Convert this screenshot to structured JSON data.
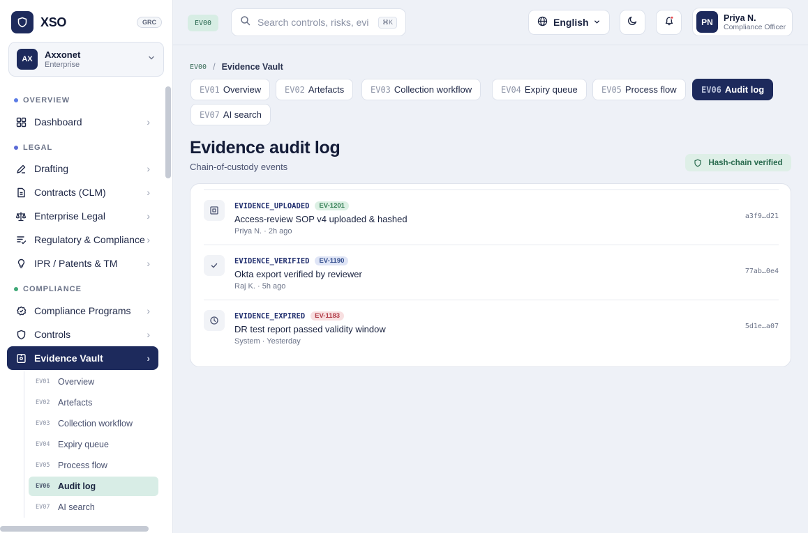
{
  "brand": {
    "name": "XSO",
    "badge": "GRC"
  },
  "org": {
    "initials": "AX",
    "name": "Axxonet",
    "plan": "Enterprise"
  },
  "sidebar": {
    "sections": [
      {
        "label": "OVERVIEW",
        "color": "#5b7ce6"
      },
      {
        "label": "LEGAL",
        "color": "#5b6bd6"
      },
      {
        "label": "COMPLIANCE",
        "color": "#3fa877"
      }
    ],
    "items": [
      {
        "label": "Dashboard",
        "icon": "grid-icon"
      },
      {
        "label": "Drafting",
        "icon": "pen-icon"
      },
      {
        "label": "Contracts (CLM)",
        "icon": "document-icon"
      },
      {
        "label": "Enterprise Legal",
        "icon": "scale-icon"
      },
      {
        "label": "Regulatory & Compliance",
        "icon": "list-check-icon"
      },
      {
        "label": "IPR / Patents & TM",
        "icon": "lightbulb-icon"
      },
      {
        "label": "Compliance Programs",
        "icon": "badge-icon"
      },
      {
        "label": "Controls",
        "icon": "shield-icon"
      },
      {
        "label": "Evidence Vault",
        "icon": "vault-icon"
      }
    ],
    "sub_items": [
      {
        "code": "EV01",
        "label": "Overview"
      },
      {
        "code": "EV02",
        "label": "Artefacts"
      },
      {
        "code": "EV03",
        "label": "Collection workflow"
      },
      {
        "code": "EV04",
        "label": "Expiry queue"
      },
      {
        "code": "EV05",
        "label": "Process flow"
      },
      {
        "code": "EV06",
        "label": "Audit log"
      },
      {
        "code": "EV07",
        "label": "AI search"
      }
    ]
  },
  "topbar": {
    "code": "EV00",
    "search_placeholder": "Search controls, risks, evidence",
    "search_shortcut": "⌘K",
    "language": "English",
    "user": {
      "initials": "PN",
      "name": "Priya N.",
      "role": "Compliance Officer"
    }
  },
  "breadcrumb": {
    "code": "EV00",
    "separator": "/",
    "label": "Evidence Vault"
  },
  "tabs": [
    {
      "code": "EV01",
      "label": "Overview"
    },
    {
      "code": "EV02",
      "label": "Artefacts"
    },
    {
      "code": "EV03",
      "label": "Collection workflow"
    },
    {
      "code": "EV04",
      "label": "Expiry queue"
    },
    {
      "code": "EV05",
      "label": "Process flow"
    },
    {
      "code": "EV06",
      "label": "Audit log"
    },
    {
      "code": "EV07",
      "label": "AI search"
    }
  ],
  "page": {
    "title": "Evidence audit log",
    "subtitle": "Chain-of-custody events",
    "verified_label": "Hash-chain verified"
  },
  "events": [
    {
      "type": "EVIDENCE_UPLOADED",
      "id": "EV-1201",
      "badge_bg": "#dcf0e4",
      "badge_fg": "#2e7a4f",
      "icon": "upload-box-icon",
      "description": "Access-review SOP v4 uploaded & hashed",
      "meta": "Priya N. · 2h ago",
      "hash": "a3f9…d21"
    },
    {
      "type": "EVIDENCE_VERIFIED",
      "id": "EV-1190",
      "badge_bg": "#dfe5f6",
      "badge_fg": "#2f4a8a",
      "icon": "check-icon",
      "description": "Okta export verified by reviewer",
      "meta": "Raj K. · 5h ago",
      "hash": "77ab…0e4"
    },
    {
      "type": "EVIDENCE_EXPIRED",
      "id": "EV-1183",
      "badge_bg": "#f8dfe0",
      "badge_fg": "#b03a46",
      "icon": "clock-icon",
      "description": "DR test report passed validity window",
      "meta": "System · Yesterday",
      "hash": "5d1e…a07"
    }
  ]
}
